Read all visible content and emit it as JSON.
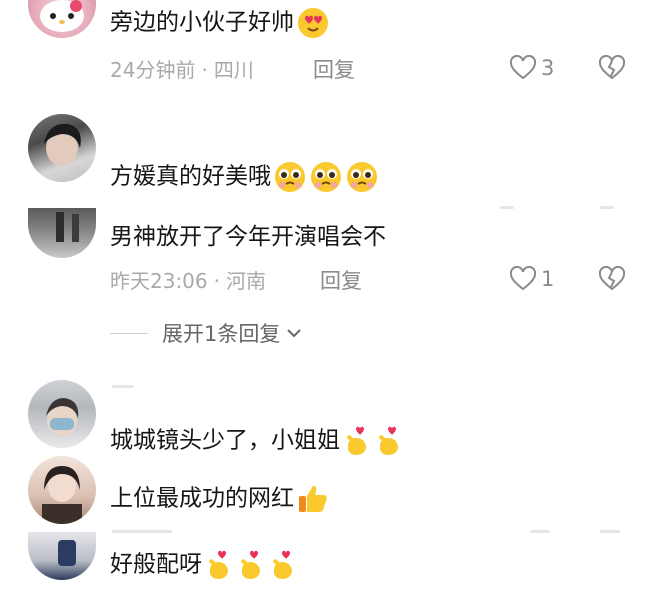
{
  "comments": [
    {
      "text": "旁边的小伙子好帅",
      "time": "24分钟前",
      "location": "四川",
      "reply": "回复",
      "likes": "3",
      "emoji": "heart-eyes-face"
    },
    {
      "text": "方媛真的好美哦",
      "emoji": "pleading-face"
    },
    {
      "text": "男神放开了今年开演唱会不",
      "time": "昨天23:06",
      "location": "河南",
      "reply": "回复",
      "likes": "1"
    },
    {
      "text": "城城镜头少了，小姐姐",
      "emoji": "finger-heart"
    },
    {
      "text": "上位最成功的网红",
      "emoji": "thumbs-up"
    },
    {
      "text": "好般配呀",
      "emoji": "finger-heart"
    }
  ],
  "expand_replies": "展开1条回复",
  "separator": "·"
}
